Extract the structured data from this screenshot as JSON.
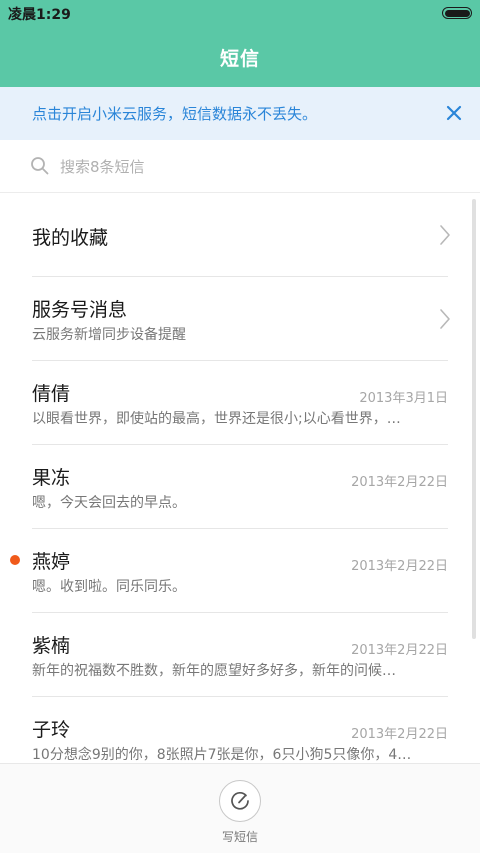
{
  "status_bar": {
    "time": "凌晨1:29"
  },
  "header": {
    "title": "短信"
  },
  "banner": {
    "text": "点击开启小米云服务，短信数据永不丢失。"
  },
  "search": {
    "placeholder": "搜索8条短信"
  },
  "list": {
    "favorites": {
      "title": "我的收藏"
    },
    "service": {
      "title": "服务号消息",
      "subtitle": "云服务新增同步设备提醒"
    },
    "conversations": [
      {
        "name": "倩倩",
        "date": "2013年3月1日",
        "preview": "以眼看世界，即使站的最高，世界还是很小;以心看世界，…",
        "unread": false
      },
      {
        "name": "果冻",
        "date": "2013年2月22日",
        "preview": "嗯，今天会回去的早点。",
        "unread": false
      },
      {
        "name": "燕婷",
        "date": "2013年2月22日",
        "preview": "嗯。收到啦。同乐同乐。",
        "unread": true
      },
      {
        "name": "紫楠",
        "date": "2013年2月22日",
        "preview": "新年的祝福数不胜数，新年的愿望好多好多，新年的问候…",
        "unread": false
      },
      {
        "name": "子玲",
        "date": "2013年2月22日",
        "preview": "10分想念9别的你，8张照片7张是你，6只小狗5只像你，4…",
        "unread": false
      }
    ]
  },
  "bottom_bar": {
    "compose_label": "写短信"
  },
  "colors": {
    "header_bg": "#5ac8a6",
    "banner_bg": "#e7f1fb",
    "banner_text": "#2a85d8",
    "unread_dot": "#f05a1a"
  },
  "icons": {
    "banner_close": "close-icon",
    "search": "search-icon",
    "chevron": "chevron-right-icon",
    "compose": "compose-icon"
  }
}
